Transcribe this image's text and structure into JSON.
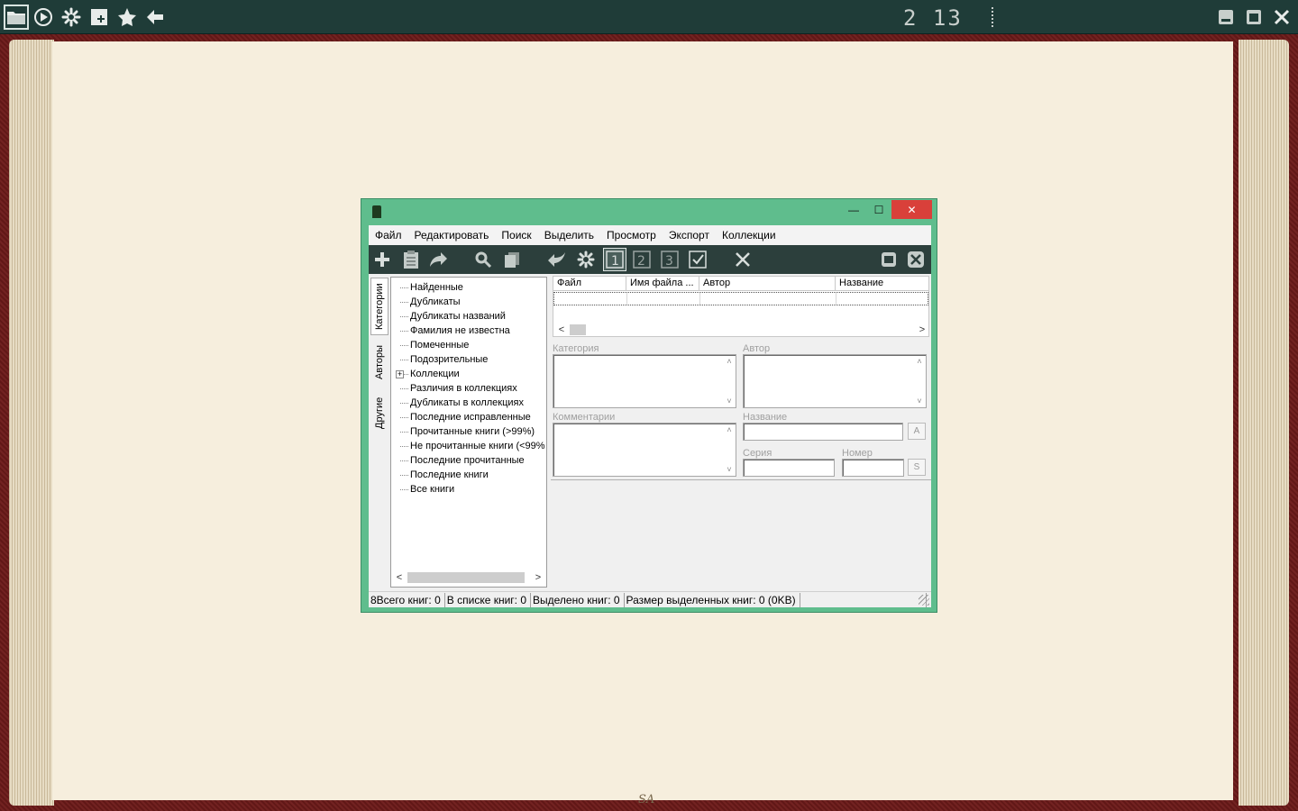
{
  "reader": {
    "toolbar_icons": [
      "open-folder-icon",
      "play-icon",
      "settings-gear-icon",
      "add-page-icon",
      "star-icon",
      "back-arrow-icon"
    ],
    "page_counter": "2 13",
    "spine_mark": "SA"
  },
  "app": {
    "window_controls": {
      "minimize": "—",
      "maximize": "☐",
      "close": "✕"
    },
    "menu": [
      "Файл",
      "Редактировать",
      "Поиск",
      "Выделить",
      "Просмотр",
      "Экспорт",
      "Коллекции"
    ],
    "tabs": [
      "Категории",
      "Авторы",
      "Другие"
    ],
    "tree_items": [
      "Найденные",
      "Дубликаты",
      "Дубликаты названий",
      "Фамилия не известна",
      "Помеченные",
      "Подозрительные",
      "Коллекции",
      "Различия в коллекциях",
      "Дубликаты в коллекциях",
      "Последние исправленные",
      "Прочитанные книги (>99%)",
      "Не прочитанные книги (<99%",
      "Последние прочитанные",
      "Последние книги",
      "Все книги"
    ],
    "grid_columns": [
      "Файл",
      "Имя файла ...",
      "Автор",
      "Название"
    ],
    "fields": {
      "category": "Категория",
      "author": "Автор",
      "comments": "Комментарии",
      "title": "Название",
      "series": "Серия",
      "number": "Номер",
      "title_btn": "A",
      "number_btn": "S"
    },
    "status": [
      "8Всего книг: 0",
      "В списке книг: 0",
      "Выделено книг: 0",
      "Размер выделенных книг: 0  (0KB)",
      ""
    ]
  },
  "colors": {
    "window_frame": "#5fbd8d",
    "toolbar_bg": "#2c3f3c",
    "close_btn": "#d9403a",
    "topbar": "#1f3c38"
  }
}
